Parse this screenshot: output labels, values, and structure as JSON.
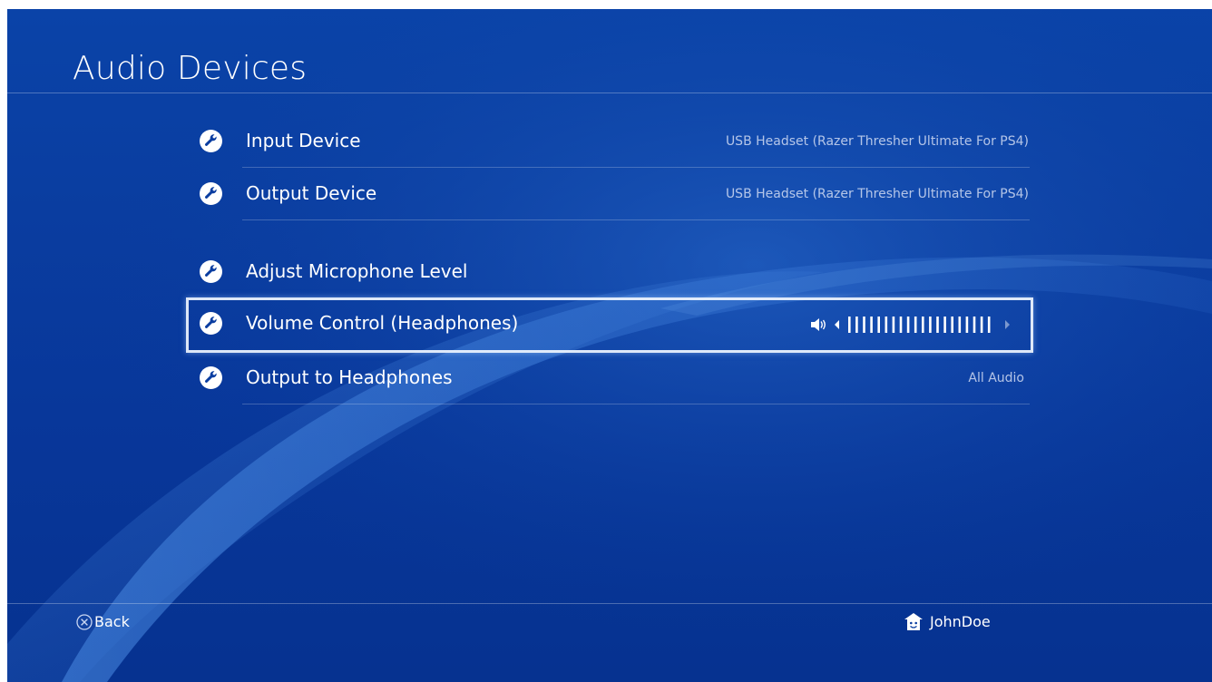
{
  "page": {
    "title": "Audio Devices"
  },
  "settings": {
    "items": [
      {
        "icon": "wrench-icon",
        "label": "Input Device",
        "value": "USB Headset (Razer Thresher Ultimate For PS4)"
      },
      {
        "icon": "wrench-icon",
        "label": "Output Device",
        "value": "USB Headset (Razer Thresher Ultimate For PS4)"
      },
      {
        "icon": "wrench-icon",
        "label": "Adjust Microphone Level",
        "value": ""
      },
      {
        "icon": "wrench-icon",
        "label": "Volume Control (Headphones)",
        "volume_level": 1.0,
        "volume_steps": 20,
        "selected": true
      },
      {
        "icon": "wrench-icon",
        "label": "Output to Headphones",
        "value": "All Audio"
      }
    ]
  },
  "footer": {
    "back_button_icon": "cross-button-icon",
    "back_label": "Back",
    "user_icon": "user-avatar-icon",
    "username": "JohnDoe"
  },
  "colors": {
    "background": "#0a3da0",
    "text": "#ffffff",
    "secondary_text": "#e1e8f8",
    "selection_border": "#f0f6ff"
  }
}
